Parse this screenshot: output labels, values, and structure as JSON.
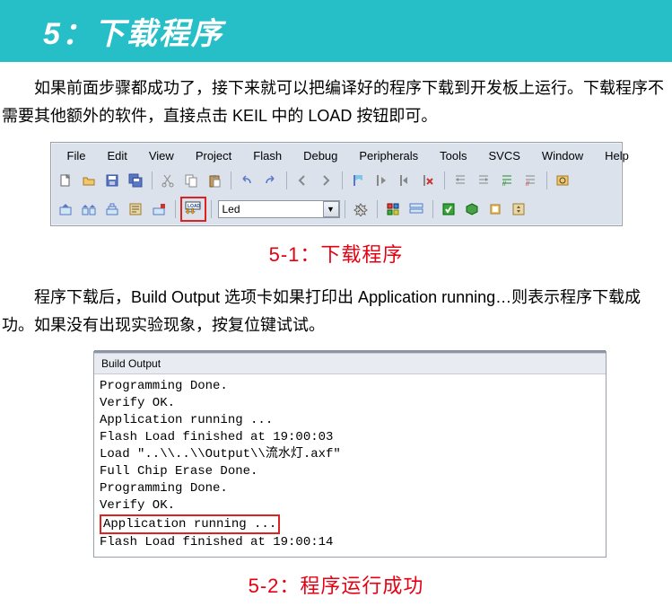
{
  "header_title": "5：下载程序",
  "paragraph1": "如果前面步骤都成功了，接下来就可以把编译好的程序下载到开发板上运行。下载程序不需要其他额外的软件，直接点击 KEIL 中的 LOAD 按钮即可。",
  "keil": {
    "menu": [
      "File",
      "Edit",
      "View",
      "Project",
      "Flash",
      "Debug",
      "Peripherals",
      "Tools",
      "SVCS",
      "Window",
      "Help"
    ],
    "combo_value": "Led"
  },
  "caption1": "5-1：下载程序",
  "paragraph2": "程序下载后，Build Output 选项卡如果打印出 Application running…则表示程序下载成功。如果没有出现实验现象，按复位键试试。",
  "build_output": {
    "tab": "Build Output",
    "lines": [
      "Programming Done.",
      "Verify OK.",
      "Application running ...",
      "Flash Load finished at 19:00:03",
      "Load \"..\\\\..\\\\Output\\\\流水灯.axf\"",
      "Full Chip Erase Done.",
      "Programming Done.",
      "Verify OK."
    ],
    "highlight_line": "Application running ...",
    "last_line": "Flash Load finished at 19:00:14"
  },
  "caption2": "5-2：程序运行成功"
}
